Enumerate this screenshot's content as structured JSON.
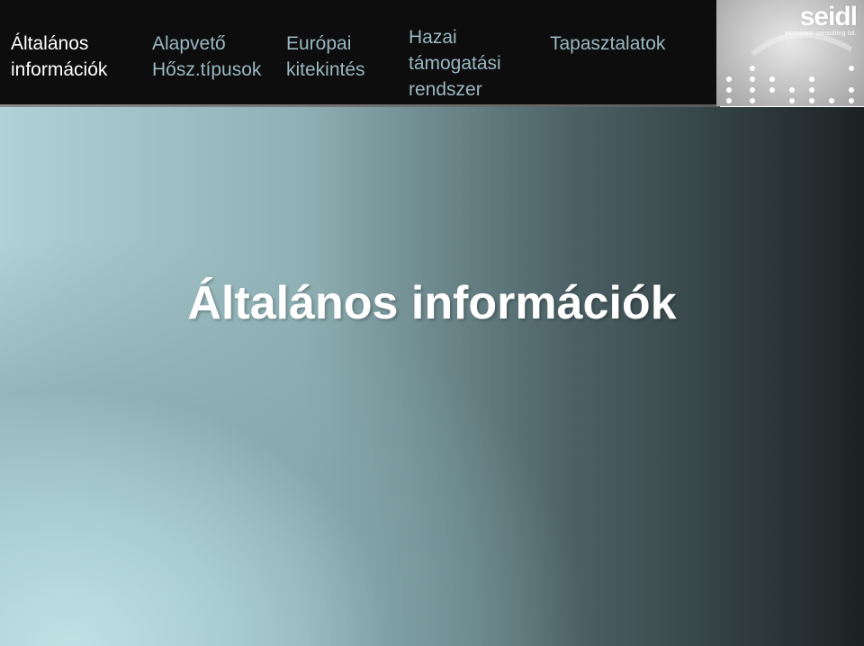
{
  "nav": {
    "items": [
      {
        "lines": [
          "Általános",
          "információk"
        ],
        "active": true
      },
      {
        "lines": [
          "Alapvető",
          "Hősz.típusok"
        ],
        "active": false
      },
      {
        "lines": [
          "Európai",
          "kitekintés"
        ],
        "active": false
      },
      {
        "lines": [
          "Hazai",
          "támogatási",
          "rendszer"
        ],
        "active": false
      },
      {
        "lines": [
          "Tapasztalatok"
        ],
        "active": false
      }
    ]
  },
  "logo": {
    "word": "seidl",
    "tagline": "economic consulting ltd."
  },
  "slide": {
    "title": "Általános információk"
  },
  "colors": {
    "topbar": "#0d0d0d",
    "nav_active": "#ffffff",
    "nav_inactive": "#9ab8c2",
    "title": "#ffffff"
  }
}
